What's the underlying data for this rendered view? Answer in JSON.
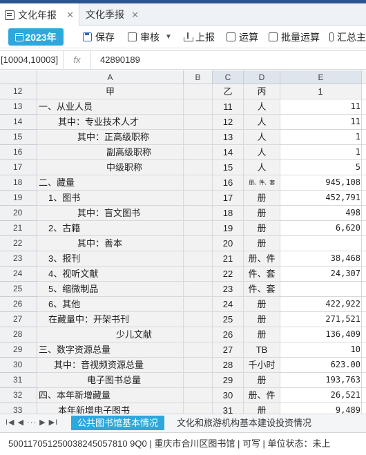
{
  "tabs": [
    {
      "label": "文化年报",
      "active": true
    },
    {
      "label": "文化季报",
      "active": false
    }
  ],
  "toolbar": {
    "year": "2023年",
    "save": "保存",
    "audit": "审核",
    "upload": "上报",
    "calc": "运算",
    "batch_calc": "批量运算",
    "summary": "汇总主"
  },
  "formula_bar": {
    "cell_ref": "[10004,10003]",
    "fx": "fx",
    "value": "42890189"
  },
  "columns": [
    "A",
    "B",
    "C",
    "D",
    "E"
  ],
  "rows": [
    {
      "n": "12",
      "a": "甲",
      "c": "乙",
      "d": "丙",
      "e": "1"
    },
    {
      "n": "13",
      "a": "一、从业人员",
      "c": "11",
      "d": "人",
      "e": "11"
    },
    {
      "n": "14",
      "a": "其中：专业技术人才",
      "c": "12",
      "d": "人",
      "e": "11"
    },
    {
      "n": "15",
      "a": "其中：正高级职称",
      "c": "13",
      "d": "人",
      "e": "1"
    },
    {
      "n": "16",
      "a": "副高级职称",
      "c": "14",
      "d": "人",
      "e": "1"
    },
    {
      "n": "17",
      "a": "中级职称",
      "c": "15",
      "d": "人",
      "e": "5"
    },
    {
      "n": "18",
      "a": "二、藏量",
      "c": "16",
      "d": "册、件、套",
      "e": "945,108"
    },
    {
      "n": "19",
      "a": "1、图书",
      "c": "17",
      "d": "册",
      "e": "452,791"
    },
    {
      "n": "20",
      "a": "其中：盲文图书",
      "c": "18",
      "d": "册",
      "e": "498"
    },
    {
      "n": "21",
      "a": "2、古籍",
      "c": "19",
      "d": "册",
      "e": "6,620"
    },
    {
      "n": "22",
      "a": "其中：善本",
      "c": "20",
      "d": "册",
      "e": ""
    },
    {
      "n": "23",
      "a": "3、报刊",
      "c": "21",
      "d": "册、件",
      "e": "38,468"
    },
    {
      "n": "24",
      "a": "4、视听文献",
      "c": "22",
      "d": "件、套",
      "e": "24,307"
    },
    {
      "n": "25",
      "a": "5、缩微制品",
      "c": "23",
      "d": "件、套",
      "e": ""
    },
    {
      "n": "26",
      "a": "6、其他",
      "c": "24",
      "d": "册",
      "e": "422,922"
    },
    {
      "n": "27",
      "a": "在藏量中：开架书刊",
      "c": "25",
      "d": "册",
      "e": "271,521"
    },
    {
      "n": "28",
      "a": "少儿文献",
      "c": "26",
      "d": "册",
      "e": "136,409"
    },
    {
      "n": "29",
      "a": "三、数字资源总量",
      "c": "27",
      "d": "TB",
      "e": "10"
    },
    {
      "n": "30",
      "a": "其中：音视频资源总量",
      "c": "28",
      "d": "千小时",
      "e": "623.00"
    },
    {
      "n": "31",
      "a": "电子图书总量",
      "c": "29",
      "d": "册",
      "e": "193,763"
    },
    {
      "n": "32",
      "a": "四、本年新增藏量",
      "c": "30",
      "d": "册、件",
      "e": "26,521"
    },
    {
      "n": "33",
      "a": "本年新增电子图书",
      "c": "31",
      "d": "册",
      "e": "9,489"
    }
  ],
  "sheet_nav": "I◀ ◀ ··· ▶ ▶I",
  "sheets": [
    {
      "label": "公共图书馆基本情况",
      "active": true
    },
    {
      "label": "文化和旅游机构基本建设投资情况",
      "active": false
    }
  ],
  "status": {
    "text": "500117051250038245057810 9Q0 | 重庆市合川区图书馆  |  可写  |  单位状态：未上"
  },
  "colors": {
    "accent": "#2fa7dd",
    "topbar": "#2b5591"
  }
}
